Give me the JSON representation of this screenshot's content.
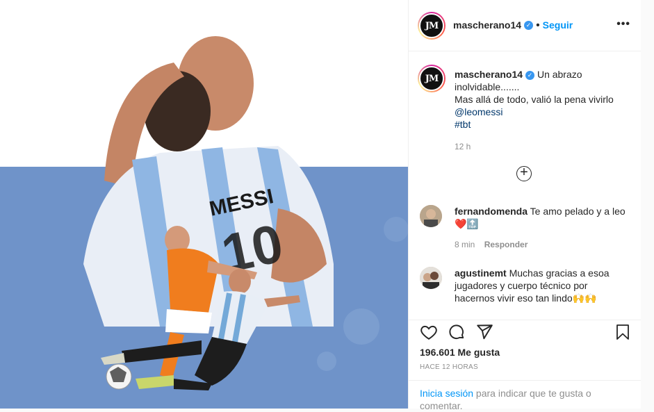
{
  "post": {
    "author": "mascherano14",
    "follow_label": "Seguir",
    "dot": "•",
    "more_label": "•••",
    "avatar_initials": "JM",
    "caption": {
      "line1": "Un abrazo",
      "line2": "inolvidable.......",
      "line3": "Mas allá de todo, valió la pena vivirlo",
      "mention": "@leomessi",
      "hashtag": "#tbt",
      "time": "12 h"
    },
    "load_more_label": "+",
    "image": {
      "jersey_name": "MESSI",
      "jersey_number": "10",
      "colors": {
        "sky": "#6f93c9",
        "white": "#ffffff",
        "orange": "#f07d1e",
        "argentina_blue": "#74a9d8"
      }
    }
  },
  "comments": [
    {
      "user": "fernandomenda",
      "text": "Te amo pelado y a leo",
      "emoji": "❤️🔝",
      "time": "8 min",
      "reply_label": "Responder"
    },
    {
      "user": "agustinemt",
      "text": "Muchas gracias a esoa jugadores y cuerpo técnico por hacernos vivir eso tan lindo",
      "emoji": "🙌🙌"
    }
  ],
  "actions": {
    "icons": [
      "heart-icon",
      "comment-icon",
      "share-icon",
      "bookmark-icon"
    ],
    "likes_label": "196.601 Me gusta",
    "time_label": "HACE 12 HORAS",
    "login_link": "Inicia sesión",
    "login_text": " para indicar que te gusta o comentar."
  }
}
